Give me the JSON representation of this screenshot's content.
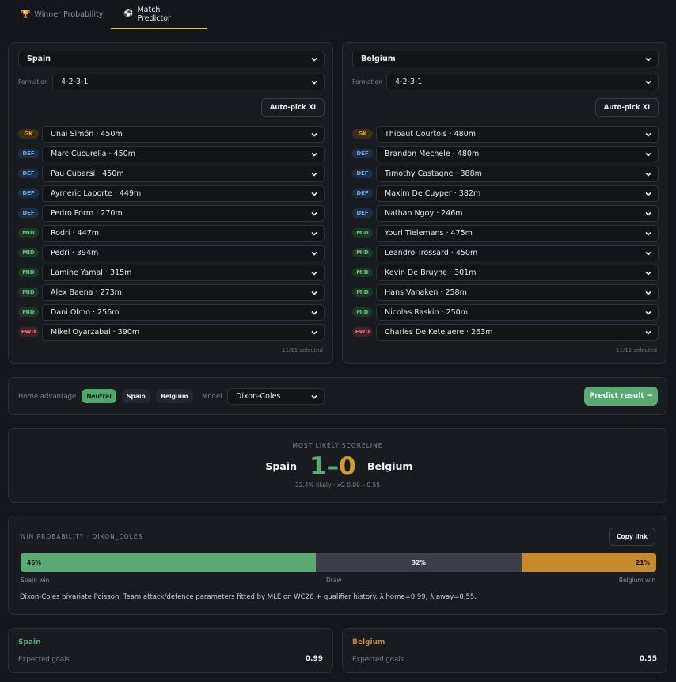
{
  "tabs": [
    {
      "label": "Winner Probability",
      "icon": "trophy-icon"
    },
    {
      "label": "Match Predictor",
      "icon": "soccer-ball-icon"
    }
  ],
  "teams": {
    "home": {
      "name": "Spain",
      "formation_label": "Formation",
      "formation": "4-2-3-1",
      "autopick_label": "Auto-pick XI",
      "selected_count": "11/11 selected",
      "players": [
        {
          "pos": "GK",
          "name": "Unai Simón · 450m"
        },
        {
          "pos": "DEF",
          "name": "Marc Cucurella · 450m"
        },
        {
          "pos": "DEF",
          "name": "Pau Cubarsí · 450m"
        },
        {
          "pos": "DEF",
          "name": "Aymeric Laporte · 449m"
        },
        {
          "pos": "DEF",
          "name": "Pedro Porro · 270m"
        },
        {
          "pos": "MID",
          "name": "Rodri · 447m"
        },
        {
          "pos": "MID",
          "name": "Pedri · 394m"
        },
        {
          "pos": "MID",
          "name": "Lamine Yamal · 315m"
        },
        {
          "pos": "MID",
          "name": "Álex Baena · 273m"
        },
        {
          "pos": "MID",
          "name": "Dani Olmo · 256m"
        },
        {
          "pos": "FWD",
          "name": "Mikel Oyarzabal · 390m"
        }
      ]
    },
    "away": {
      "name": "Belgium",
      "formation_label": "Formation",
      "formation": "4-2-3-1",
      "autopick_label": "Auto-pick XI",
      "selected_count": "11/11 selected",
      "players": [
        {
          "pos": "GK",
          "name": "Thibaut Courtois · 480m"
        },
        {
          "pos": "DEF",
          "name": "Brandon Mechele · 480m"
        },
        {
          "pos": "DEF",
          "name": "Timothy Castagne · 388m"
        },
        {
          "pos": "DEF",
          "name": "Maxim De Cuyper · 382m"
        },
        {
          "pos": "DEF",
          "name": "Nathan Ngoy · 246m"
        },
        {
          "pos": "MID",
          "name": "Youri Tielemans · 475m"
        },
        {
          "pos": "MID",
          "name": "Leandro Trossard · 450m"
        },
        {
          "pos": "MID",
          "name": "Kevin De Bruyne · 301m"
        },
        {
          "pos": "MID",
          "name": "Hans Vanaken · 258m"
        },
        {
          "pos": "MID",
          "name": "Nicolas Raskin · 250m"
        },
        {
          "pos": "FWD",
          "name": "Charles De Ketelaere · 263m"
        }
      ]
    }
  },
  "controls": {
    "home_advantage_label": "Home advantage",
    "options": [
      "Neutral",
      "Spain",
      "Belgium"
    ],
    "selected_option": "Neutral",
    "model_label": "Model",
    "model": "Dixon-Coles",
    "predict_label": "Predict result →"
  },
  "scoreline": {
    "caption": "MOST LIKELY SCORELINE",
    "home": "Spain",
    "away": "Belgium",
    "score": "1–0",
    "detail": "22.4% likely · xG 0.99 – 0.55"
  },
  "probability": {
    "caption": "WIN PROBABILITY · DIXON_COLES",
    "copy_label": "Copy link",
    "home_pct": 0.46,
    "draw_pct": 0.32,
    "away_pct": 0.21,
    "home_text": "46%",
    "draw_text": "32%",
    "away_text": "21%",
    "home_label": "Spain win",
    "draw_label": "Draw",
    "away_label": "Belgium win",
    "description": "Dixon-Coles bivariate Poisson. Team attack/defence parameters fitted by MLE on WC26 + qualifier history. λ home=0.99, λ away=0.55."
  },
  "summary": {
    "home": {
      "name": "Spain",
      "metric": "Expected goals",
      "value": "0.99"
    },
    "away": {
      "name": "Belgium",
      "metric": "Expected goals",
      "value": "0.55"
    }
  },
  "colors": {
    "home": "#5aa872",
    "draw": "#3a3f4a",
    "away": "#c8892a",
    "score": "#c9a227"
  }
}
